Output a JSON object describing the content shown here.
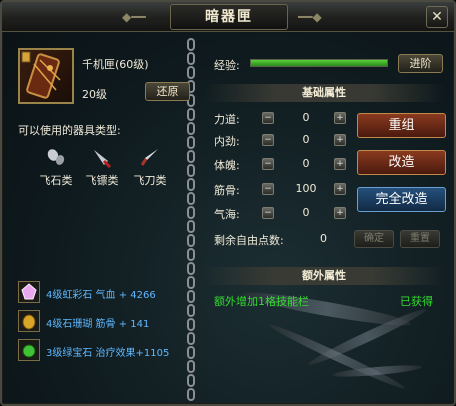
{
  "window": {
    "title": "暗器匣",
    "close_label": "✕"
  },
  "item": {
    "name": "千机匣(60级)",
    "level": "20级",
    "restore_label": "还原"
  },
  "usable_types": {
    "label": "可以使用的器具类型:",
    "types": [
      {
        "label": "飞石类",
        "icon": "flying-stone-icon"
      },
      {
        "label": "飞镖类",
        "icon": "dart-icon"
      },
      {
        "label": "飞刀类",
        "icon": "flying-knife-icon"
      }
    ]
  },
  "gems": [
    {
      "text": "4级虹彩石 气血 + 4266",
      "color": "#e6a2e8"
    },
    {
      "text": "4级石珊瑚 筋骨 + 141",
      "color": "#e0b030"
    },
    {
      "text": "3级绿宝石 治疗效果+1105",
      "color": "#3cc23a"
    }
  ],
  "experience": {
    "label": "经验:",
    "progress": 1.0,
    "advance_label": "进阶"
  },
  "basic_attributes": {
    "header": "基础属性",
    "rows": [
      {
        "name": "力道:",
        "value": "0"
      },
      {
        "name": "内劲:",
        "value": "0"
      },
      {
        "name": "体魄:",
        "value": "0"
      },
      {
        "name": "筋骨:",
        "value": "100"
      },
      {
        "name": "气海:",
        "value": "0"
      }
    ],
    "free_points_label": "剩余自由点数:",
    "free_points_value": "0",
    "confirm_label": "确定",
    "reset_label": "重置"
  },
  "actions": {
    "reorganize_label": "重组",
    "forge_label": "改造",
    "full_forge_label": "完全改造"
  },
  "extra_attributes": {
    "header": "额外属性",
    "text": "额外增加1格技能栏",
    "status": "已获得"
  },
  "colors": {
    "gem_text": "#5fb8ff",
    "extra_text": "#33dd2e",
    "exp_bar": "#4ac42c"
  }
}
